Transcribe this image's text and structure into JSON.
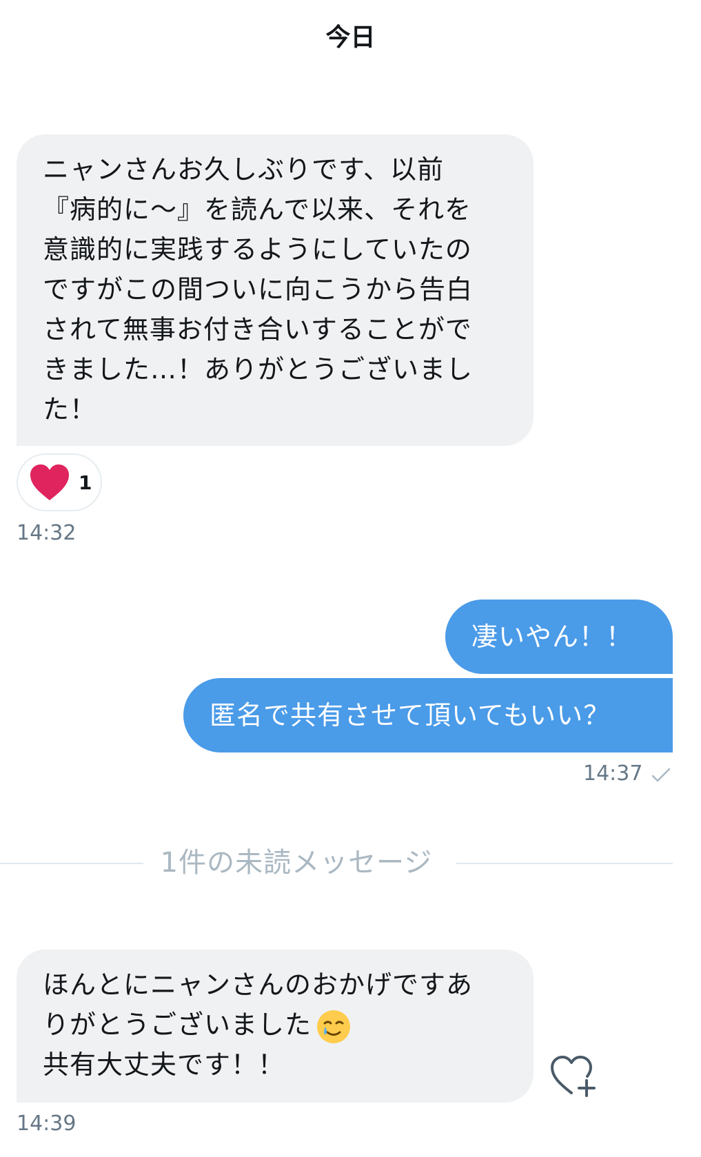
{
  "header": {
    "date": "今日"
  },
  "messages": {
    "m1": {
      "lines": [
        "ニャンさんお久しぶりです、以前",
        "『病的に〜』を読んで以来、それを",
        "意識的に実践するようにしていたの",
        "ですがこの間ついに向こうから告白",
        "されて無事お付き合いすることがで",
        "きました…！ありがとうございまし",
        "た！"
      ],
      "reaction_count": "1",
      "time": "14:32"
    },
    "m2": {
      "text": "凄いやん！！"
    },
    "m3": {
      "text": "匿名で共有させて頂いてもいい？",
      "time": "14:37"
    },
    "m4": {
      "line1": "ほんとにニャンさんのおかげですあ",
      "line2": "りがとうございました",
      "line3": "共有大丈夫です！！",
      "time": "14:39"
    }
  },
  "divider": {
    "text": "1件の未読メッセージ"
  },
  "colors": {
    "incoming_bubble": "#eff1f3",
    "outgoing_bubble": "#4a9be8",
    "heart": "#e0245e",
    "meta_text": "#657786"
  },
  "icons": {
    "reaction": "heart-icon",
    "read_receipt": "checkmark-icon",
    "add_reaction": "heart-plus-icon",
    "emoji": "smiling-face-with-tear-emoji"
  }
}
